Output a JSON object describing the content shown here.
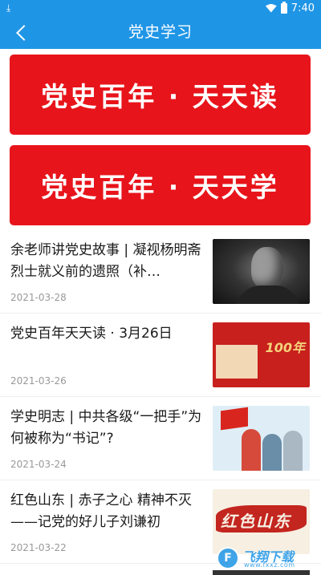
{
  "status_bar": {
    "time": "7:40",
    "download_glyph": "⤓"
  },
  "app_bar": {
    "title": "党史学习"
  },
  "banners": [
    {
      "label": "党史百年 · 天天读"
    },
    {
      "label": "党史百年 · 天天学"
    }
  ],
  "articles": [
    {
      "headline": "余老师讲党史故事 | 凝视杨明斋烈士就义前的遗照（补…",
      "date": "2021-03-28"
    },
    {
      "headline": "党史百年天天读 · 3月26日",
      "date": "2021-03-26",
      "thumb_text": "100年"
    },
    {
      "headline": "学史明志 | 中共各级“一把手”为何被称为“书记”?",
      "date": "2021-03-24"
    },
    {
      "headline": "红色山东 | 赤子之心 精神不灭 ——记党的好儿子刘谦初",
      "date": "2021-03-22",
      "thumb_text": "红色山东"
    }
  ],
  "watermark": {
    "main": "飞翔下载",
    "sub": "www.fxxz.com",
    "mark": "F"
  },
  "colors": {
    "primary": "#1f95e6",
    "banner_red": "#e8141b"
  }
}
